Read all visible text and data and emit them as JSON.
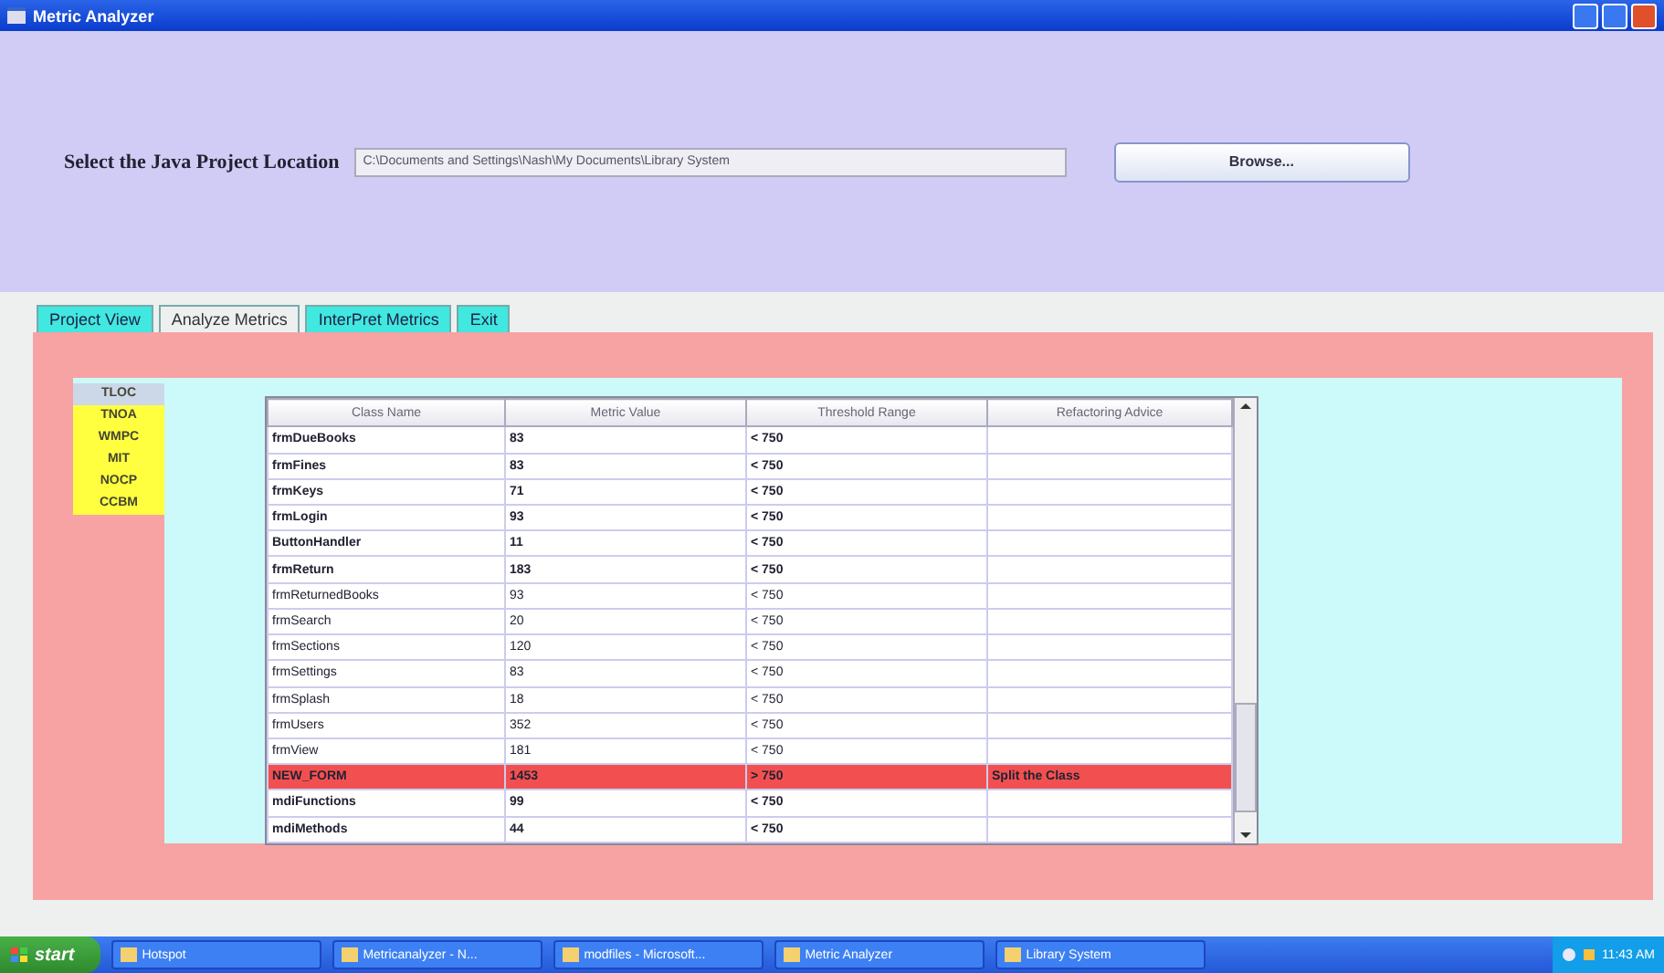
{
  "window": {
    "title": "Metric Analyzer"
  },
  "location": {
    "label": "Select the Java Project Location",
    "value": "C:\\Documents and Settings\\Nash\\My Documents\\Library System",
    "button": "Browse..."
  },
  "tabs": [
    {
      "label": "Project View",
      "selected": false
    },
    {
      "label": "Analyze Metrics",
      "selected": true
    },
    {
      "label": "InterPret Metrics",
      "selected": false
    },
    {
      "label": "Exit",
      "selected": false
    }
  ],
  "metrics": [
    {
      "label": "TLOC",
      "selected": true
    },
    {
      "label": "TNOA",
      "selected": false
    },
    {
      "label": "WMPC",
      "selected": false
    },
    {
      "label": "MIT",
      "selected": false
    },
    {
      "label": "NOCP",
      "selected": false
    },
    {
      "label": "CCBM",
      "selected": false
    }
  ],
  "table": {
    "columns": [
      "Class Name",
      "Metric Value",
      "Threshold Range",
      "Refactoring Advice"
    ],
    "rows": [
      {
        "cells": [
          "frmDueBooks",
          "83",
          "< 750",
          ""
        ],
        "bold": true,
        "highlighted": false
      },
      {
        "cells": [
          "frmFines",
          "83",
          "< 750",
          ""
        ],
        "bold": true,
        "highlighted": false
      },
      {
        "cells": [
          "frmKeys",
          "71",
          "< 750",
          ""
        ],
        "bold": true,
        "highlighted": false
      },
      {
        "cells": [
          "frmLogin",
          "93",
          "< 750",
          ""
        ],
        "bold": true,
        "highlighted": false
      },
      {
        "cells": [
          "ButtonHandler",
          "11",
          "< 750",
          ""
        ],
        "bold": true,
        "highlighted": false
      },
      {
        "cells": [
          "frmReturn",
          "183",
          "< 750",
          ""
        ],
        "bold": true,
        "highlighted": false
      },
      {
        "cells": [
          "frmReturnedBooks",
          "93",
          "< 750",
          ""
        ],
        "bold": false,
        "highlighted": false
      },
      {
        "cells": [
          "frmSearch",
          "20",
          "< 750",
          ""
        ],
        "bold": false,
        "highlighted": false
      },
      {
        "cells": [
          "frmSections",
          "120",
          "< 750",
          ""
        ],
        "bold": false,
        "highlighted": false
      },
      {
        "cells": [
          "frmSettings",
          "83",
          "< 750",
          ""
        ],
        "bold": false,
        "highlighted": false
      },
      {
        "cells": [
          "frmSplash",
          "18",
          "< 750",
          ""
        ],
        "bold": false,
        "highlighted": false
      },
      {
        "cells": [
          "frmUsers",
          "352",
          "< 750",
          ""
        ],
        "bold": false,
        "highlighted": false
      },
      {
        "cells": [
          "frmView",
          "181",
          "< 750",
          ""
        ],
        "bold": false,
        "highlighted": false
      },
      {
        "cells": [
          "NEW_FORM",
          "1453",
          "> 750",
          "Split the Class"
        ],
        "bold": true,
        "highlighted": true
      },
      {
        "cells": [
          "mdiFunctions",
          "99",
          "< 750",
          ""
        ],
        "bold": true,
        "highlighted": false
      },
      {
        "cells": [
          "mdiMethods",
          "44",
          "< 750",
          ""
        ],
        "bold": true,
        "highlighted": false
      }
    ]
  },
  "taskbar": {
    "start": "start",
    "items": [
      "Hotspot",
      "Metricanalyzer - N...",
      "modfiles - Microsoft...",
      "Metric Analyzer",
      "Library System"
    ],
    "clock": "11:43 AM"
  }
}
